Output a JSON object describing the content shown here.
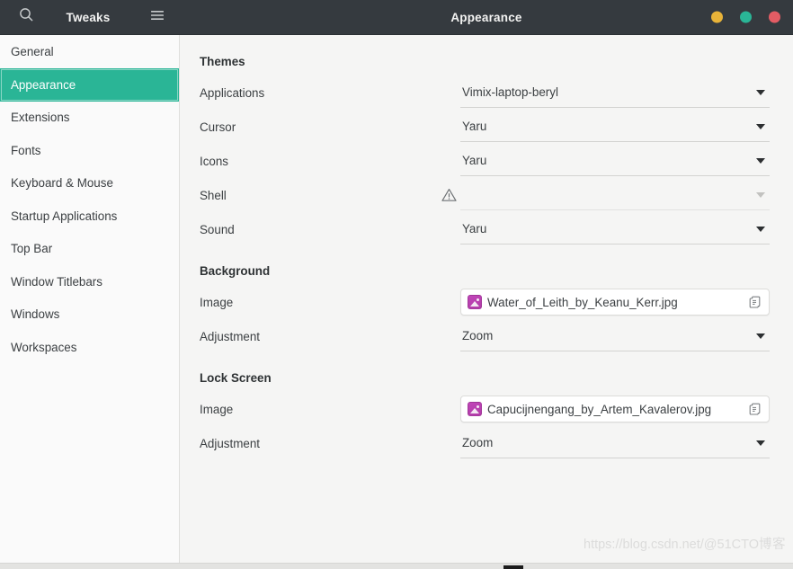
{
  "header": {
    "app_title": "Tweaks",
    "page_title": "Appearance",
    "search_icon": "search-icon",
    "menu_icon": "hamburger-menu-icon",
    "window_controls": [
      {
        "name": "minimize-button",
        "color": "#e8b339"
      },
      {
        "name": "maximize-button",
        "color": "#2ab596"
      },
      {
        "name": "close-button",
        "color": "#e45c64"
      }
    ]
  },
  "sidebar": {
    "items": [
      {
        "label": "General",
        "key": "general",
        "selected": false
      },
      {
        "label": "Appearance",
        "key": "appearance",
        "selected": true
      },
      {
        "label": "Extensions",
        "key": "extensions",
        "selected": false
      },
      {
        "label": "Fonts",
        "key": "fonts",
        "selected": false
      },
      {
        "label": "Keyboard & Mouse",
        "key": "keyboard-mouse",
        "selected": false
      },
      {
        "label": "Startup Applications",
        "key": "startup-applications",
        "selected": false
      },
      {
        "label": "Top Bar",
        "key": "top-bar",
        "selected": false
      },
      {
        "label": "Window Titlebars",
        "key": "window-titlebars",
        "selected": false
      },
      {
        "label": "Windows",
        "key": "windows",
        "selected": false
      },
      {
        "label": "Workspaces",
        "key": "workspaces",
        "selected": false
      }
    ],
    "selected_color": "#2ab596"
  },
  "content": {
    "themes": {
      "title": "Themes",
      "rows": [
        {
          "label": "Applications",
          "value": "Vimix-laptop-beryl",
          "disabled": false,
          "warning": false
        },
        {
          "label": "Cursor",
          "value": "Yaru",
          "disabled": false,
          "warning": false
        },
        {
          "label": "Icons",
          "value": "Yaru",
          "disabled": false,
          "warning": false
        },
        {
          "label": "Shell",
          "value": "",
          "disabled": true,
          "warning": true
        },
        {
          "label": "Sound",
          "value": "Yaru",
          "disabled": false,
          "warning": false
        }
      ]
    },
    "background": {
      "title": "Background",
      "image_label": "Image",
      "image_value": "Water_of_Leith_by_Keanu_Kerr.jpg",
      "image_icon": "image-file-icon",
      "chooser_icon": "documents-icon",
      "adjustment_label": "Adjustment",
      "adjustment_value": "Zoom"
    },
    "lock_screen": {
      "title": "Lock Screen",
      "image_label": "Image",
      "image_value": "Capucijnengang_by_Artem_Kavalerov.jpg",
      "image_icon": "image-file-icon",
      "chooser_icon": "documents-icon",
      "adjustment_label": "Adjustment",
      "adjustment_value": "Zoom"
    },
    "shell_warning_icon": "warning-triangle-icon"
  },
  "watermark": {
    "url": "https://blog.csdn.net/@51CTO",
    "suffix": "博客"
  },
  "colors": {
    "headerbar": "#353a3f",
    "sidebar": "#fafafa",
    "content_bg": "#f5f5f4",
    "accent": "#2ab596",
    "text": "#3b3f42"
  }
}
